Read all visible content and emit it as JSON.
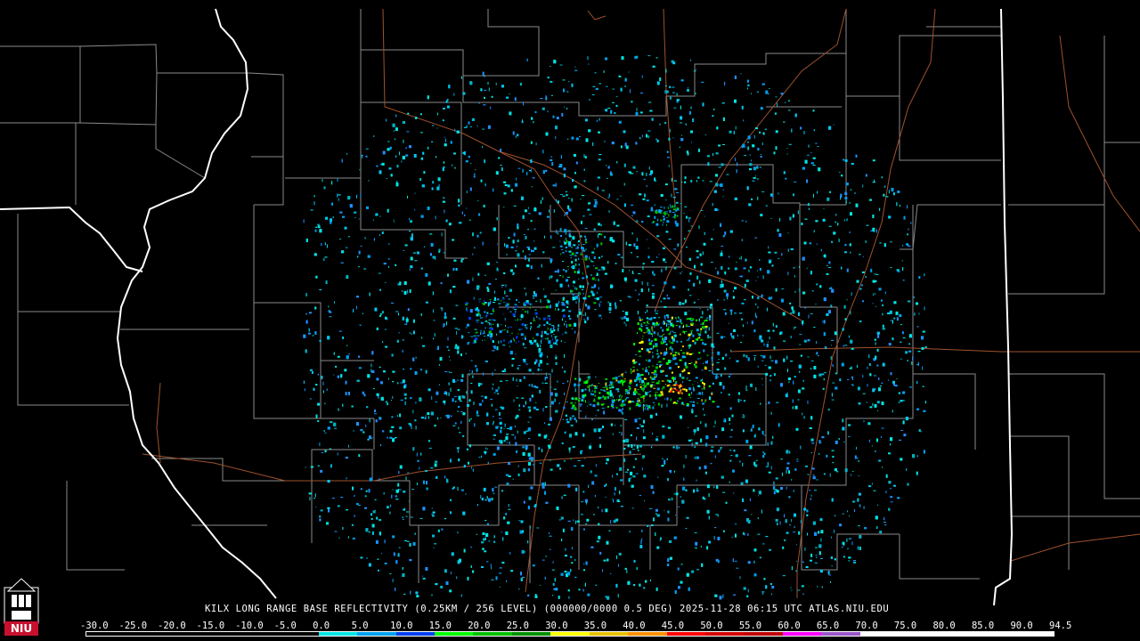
{
  "caption": "KILX LONG RANGE BASE REFLECTIVITY (0.25KM / 256 LEVEL) (000000/0000 0.5 DEG) 2025-11-28 06:15 UTC  ATLAS.NIU.EDU",
  "legend": {
    "labels": [
      "-30.0",
      "-25.0",
      "-20.0",
      "-15.0",
      "-10.0",
      "-5.0",
      "0.0",
      "5.0",
      "10.0",
      "15.0",
      "20.0",
      "25.0",
      "30.0",
      "35.0",
      "40.0",
      "45.0",
      "50.0",
      "55.0",
      "60.0",
      "65.0",
      "70.0",
      "75.0",
      "80.0",
      "85.0",
      "90.0",
      "94.5"
    ],
    "colors": [
      "#000000",
      "#000000",
      "#000000",
      "#000000",
      "#000000",
      "#000000",
      "#00e5e5",
      "#00a0f0",
      "#0040f0",
      "#00ff00",
      "#00c000",
      "#009000",
      "#ffff00",
      "#e7c000",
      "#ff9000",
      "#ff0000",
      "#d40000",
      "#c00000",
      "#ff00ff",
      "#9955c9",
      "#ffffff",
      "#ffffff",
      "#ffffff",
      "#ffffff",
      "#ffffff"
    ]
  },
  "logo": {
    "text": "NIU",
    "icon": "university-tower-icon"
  },
  "map": {
    "background": "#000000",
    "county_line_color": "#8a8a8a",
    "state_line_color": "#ffffff",
    "highway_color": "#a0522d"
  }
}
